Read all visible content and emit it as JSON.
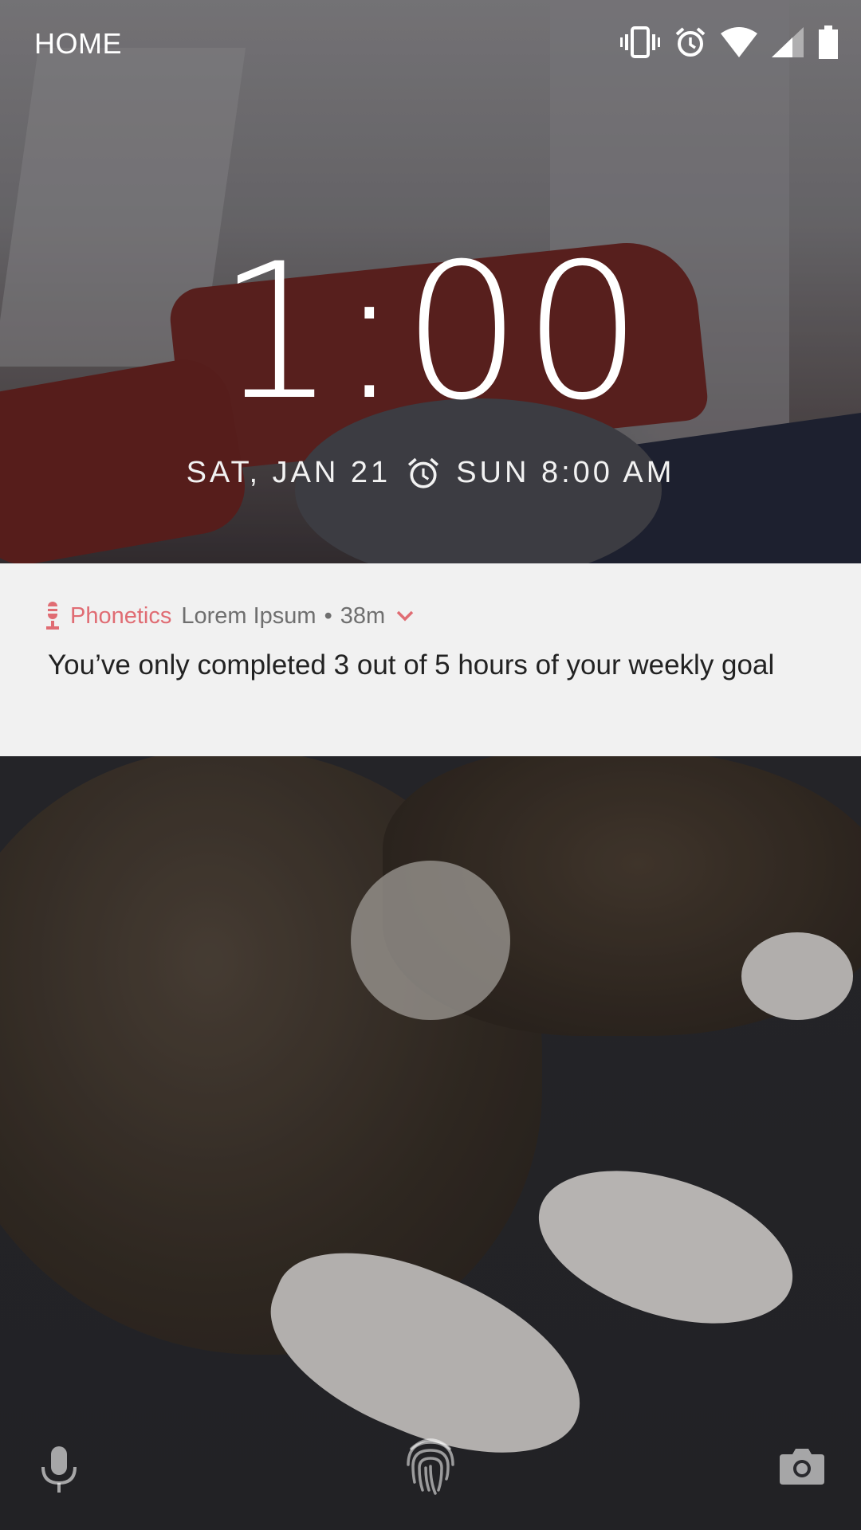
{
  "status_bar": {
    "carrier_label": "HOME",
    "icons": [
      "vibrate-icon",
      "alarm-icon",
      "wifi-icon",
      "cell-signal-icon",
      "battery-icon"
    ]
  },
  "lock_screen": {
    "time": "1:00",
    "date": "SAT, JAN 21",
    "alarm_icon": "alarm-clock-icon",
    "next_alarm": "SUN 8:00 AM"
  },
  "notification": {
    "app_icon": "microphone-icon",
    "app_name": "Phonetics",
    "subtext": "Lorem Ipsum",
    "separator": "•",
    "time_ago": "38m",
    "expand_icon": "chevron-down-icon",
    "message": "You’ve only completed 3 out of 5 hours of your weekly goal"
  },
  "bottom_actions": {
    "left": "mic-icon",
    "center": "fingerprint-icon",
    "right": "camera-icon"
  },
  "colors": {
    "accent": "#e06c73",
    "notification_bg": "#f1f1f1",
    "text_secondary": "#6f6f6f",
    "text_primary": "#222222"
  }
}
